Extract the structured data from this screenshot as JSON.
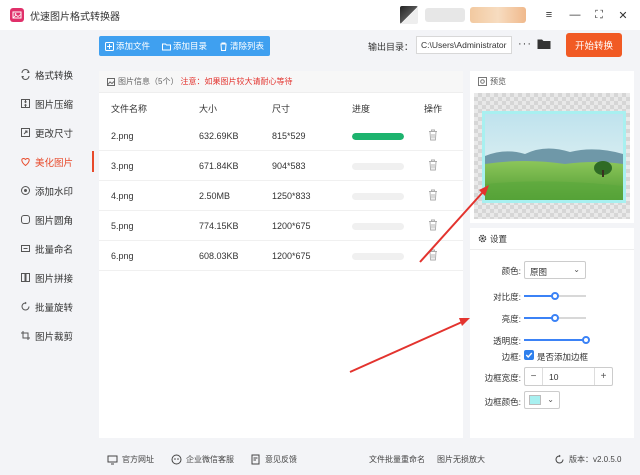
{
  "app": {
    "title": "优速图片格式转换器"
  },
  "window_controls": [
    "≡",
    "—",
    "⛶",
    "✕"
  ],
  "sidebar": {
    "items": [
      {
        "label": "格式转换",
        "icon": "convert-icon",
        "active": false
      },
      {
        "label": "图片压缩",
        "icon": "compress-icon",
        "active": false
      },
      {
        "label": "更改尺寸",
        "icon": "resize-icon",
        "active": false
      },
      {
        "label": "美化图片",
        "icon": "beautify-icon",
        "active": true
      },
      {
        "label": "添加水印",
        "icon": "watermark-icon",
        "active": false
      },
      {
        "label": "图片圆角",
        "icon": "rounded-corner-icon",
        "active": false
      },
      {
        "label": "批量命名",
        "icon": "rename-icon",
        "active": false
      },
      {
        "label": "图片拼接",
        "icon": "stitch-icon",
        "active": false
      },
      {
        "label": "批量旋转",
        "icon": "rotate-icon",
        "active": false
      },
      {
        "label": "图片裁剪",
        "icon": "crop-icon",
        "active": false
      }
    ]
  },
  "toolbar": {
    "add_file": "添加文件",
    "add_folder": "添加目录",
    "clear_list": "清除列表",
    "output_label": "输出目录：",
    "output_path": "C:\\Users\\Administrator",
    "more": "···",
    "start": "开始转换"
  },
  "file_panel": {
    "title": "图片信息",
    "count": "（5个）",
    "notice": "注意：如果图片较大请耐心等待",
    "columns": [
      "文件名称",
      "大小",
      "尺寸",
      "进度",
      "操作"
    ],
    "rows": [
      {
        "name": "2.png",
        "size": "632.69KB",
        "dims": "815*529",
        "progress": 1.0
      },
      {
        "name": "3.png",
        "size": "671.84KB",
        "dims": "904*583",
        "progress": 0
      },
      {
        "name": "4.png",
        "size": "2.50MB",
        "dims": "1250*833",
        "progress": 0
      },
      {
        "name": "5.png",
        "size": "774.15KB",
        "dims": "1200*675",
        "progress": 0
      },
      {
        "name": "6.png",
        "size": "608.03KB",
        "dims": "1200*675",
        "progress": 0
      }
    ]
  },
  "preview": {
    "title": "预览"
  },
  "settings": {
    "title": "设置",
    "color_label": "颜色:",
    "color_value": "原图",
    "contrast_label": "对比度:",
    "contrast": 0.5,
    "brightness_label": "亮度:",
    "brightness": 0.5,
    "opacity_label": "透明度:",
    "opacity": 1.0,
    "border_label": "边框:",
    "border_checkbox": "是否添加边框",
    "border_width_label": "边框宽度:",
    "border_width": "10",
    "border_color_label": "边框颜色:",
    "border_color": "#a8f0f0"
  },
  "footer": {
    "website": "官方网址",
    "wechat": "企业微信客服",
    "feedback": "意见反馈",
    "batch_rename": "文件批量重命名",
    "lossless": "图片无损放大",
    "version": "版本：v2.0.5.0"
  },
  "colors": {
    "accent": "#f15a24",
    "toolbar": "#3fa0f0",
    "active": "#e84a2b",
    "progress": "#1db36e",
    "arrow": "#e3332e"
  }
}
